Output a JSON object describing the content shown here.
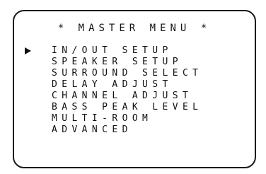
{
  "menu": {
    "title": "* MASTER MENU *",
    "selected_index": 0,
    "items": [
      {
        "label": "IN/OUT SETUP"
      },
      {
        "label": "SPEAKER SETUP"
      },
      {
        "label": "SURROUND SELECT"
      },
      {
        "label": "DELAY ADJUST"
      },
      {
        "label": "CHANNEL ADJUST"
      },
      {
        "label": "BASS PEAK LEVEL"
      },
      {
        "label": "MULTI-ROOM"
      },
      {
        "label": "ADVANCED"
      }
    ]
  }
}
